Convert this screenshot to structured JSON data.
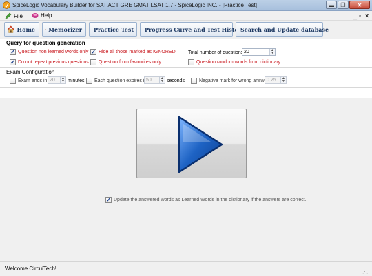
{
  "window": {
    "title": "SpiceLogic Vocabulary Builder for SAT ACT GRE GMAT LSAT 1.7 - SpiceLogic INC. - [Practice Test]",
    "minimize_icon": "minimize-icon",
    "maximize_icon": "restore-icon",
    "close_icon": "close-icon"
  },
  "menu": {
    "file": "File",
    "help": "Help",
    "mdi_minimize": "_",
    "mdi_restore": "▫",
    "mdi_close": "×"
  },
  "toolbar": {
    "home": "Home",
    "memorizer": "Memorizer",
    "practice_test": "Practice Test",
    "progress": "Progress Curve and Test History",
    "search": "Search and Update database"
  },
  "query": {
    "title": "Query for question generation",
    "non_learned": "Question non learned words only",
    "hide_ignored": "Hide all those marked as IGNORED",
    "total_label": "Total number of questions",
    "total_value": "20",
    "no_repeat": "Do not repeat previous questions",
    "favourites": "Question from favourites only",
    "random": "Question random words from dictionary"
  },
  "exam": {
    "title": "Exam Configuration",
    "ends_in": "Exam ends in",
    "ends_value": "20",
    "minutes": "minutes",
    "expires": "Each question expires in",
    "expires_value": "50",
    "seconds": "seconds",
    "negative": "Negative mark for wrong answer:",
    "negative_value": "0.25"
  },
  "main": {
    "update_label": "Update the answered words as Learned Words in the dictionary if the answers are correct."
  },
  "status": {
    "message": "Welcome CircuiTech!"
  },
  "colors": {
    "accent": "#1e63c4",
    "warning_text": "#c8151b"
  }
}
